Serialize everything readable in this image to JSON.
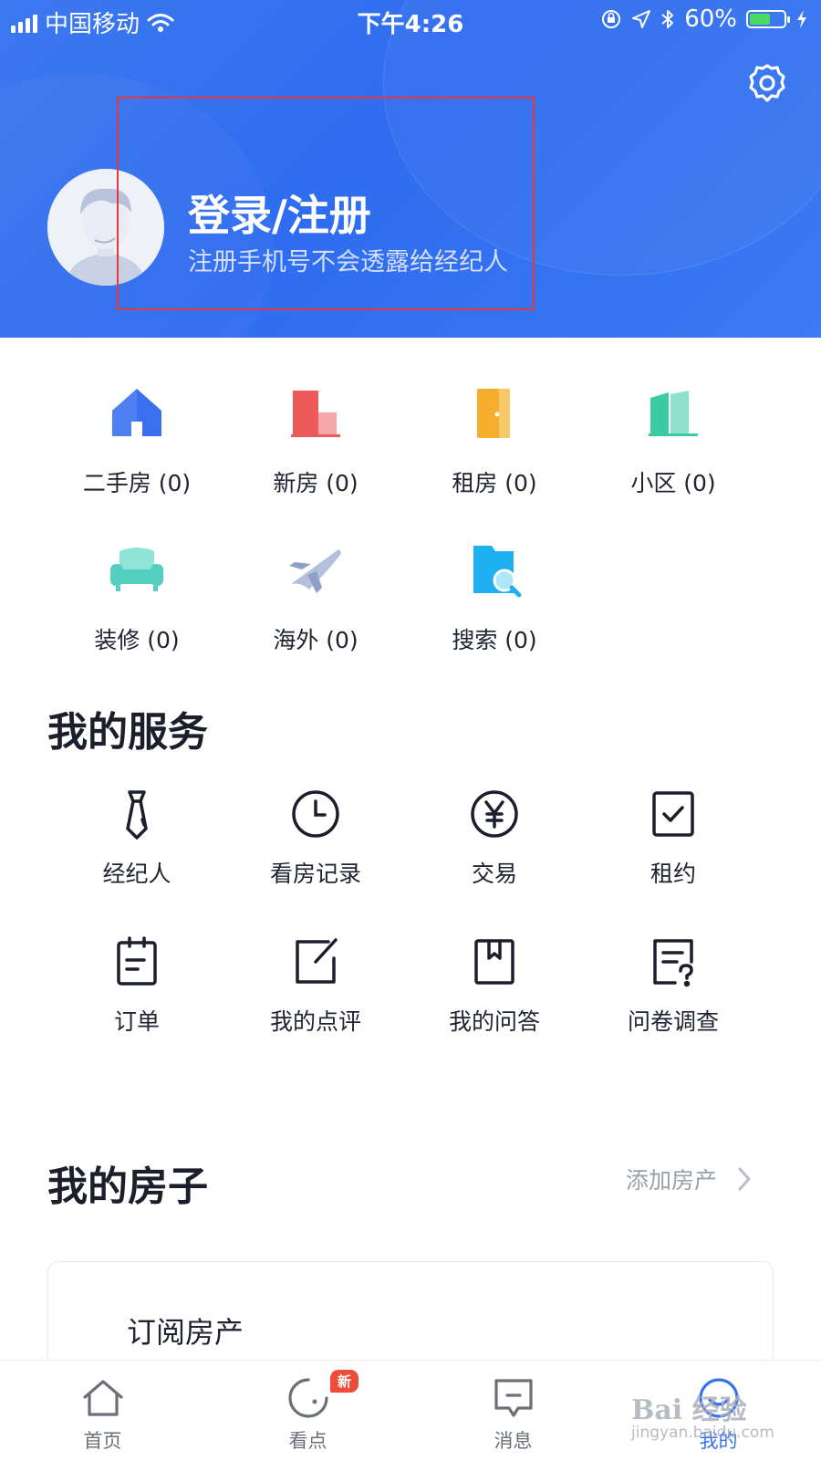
{
  "status_bar": {
    "carrier": "中国移动",
    "time": "下午4:26",
    "battery_pct": "60%",
    "battery_level": 0.6
  },
  "header": {
    "login_title": "登录/注册",
    "login_subtitle": "注册手机号不会透露给经纪人",
    "settings_icon": "gear-icon",
    "bg_color": "#3b78f0"
  },
  "categories": [
    {
      "label": "二手房 (0)",
      "icon": "house-icon",
      "color": "#3a6ff0"
    },
    {
      "label": "新房 (0)",
      "icon": "building-icon",
      "color": "#ee5a5a"
    },
    {
      "label": "租房 (0)",
      "icon": "door-icon",
      "color": "#f5ad2e"
    },
    {
      "label": "小区 (0)",
      "icon": "community-icon",
      "color": "#3ccaa5"
    },
    {
      "label": "装修 (0)",
      "icon": "sofa-icon",
      "color": "#55d0c0"
    },
    {
      "label": "海外 (0)",
      "icon": "airplane-icon",
      "color": "#8fa0c8"
    },
    {
      "label": "搜索 (0)",
      "icon": "search-folder-icon",
      "color": "#1eb0f0"
    }
  ],
  "services": {
    "title": "我的服务",
    "items": [
      {
        "label": "经纪人",
        "icon": "tie-icon"
      },
      {
        "label": "看房记录",
        "icon": "clock-icon"
      },
      {
        "label": "交易",
        "icon": "yen-icon"
      },
      {
        "label": "租约",
        "icon": "checkbox-icon"
      },
      {
        "label": "订单",
        "icon": "clipboard-icon"
      },
      {
        "label": "我的点评",
        "icon": "edit-icon"
      },
      {
        "label": "我的问答",
        "icon": "bookmark-icon"
      },
      {
        "label": "问卷调查",
        "icon": "survey-icon"
      }
    ]
  },
  "house": {
    "title": "我的房子",
    "add_label": "添加房产",
    "card_text": "订阅房产"
  },
  "tabbar": {
    "items": [
      {
        "label": "首页",
        "icon": "home-icon"
      },
      {
        "label": "看点",
        "icon": "kandian-icon",
        "badge": "新"
      },
      {
        "label": "消息",
        "icon": "message-icon"
      },
      {
        "label": "我的",
        "icon": "profile-icon",
        "active": true
      }
    ],
    "active_color": "#3572f0"
  },
  "watermark": {
    "brand": "Bai 经验",
    "url": "jingyan.baidu.com"
  }
}
